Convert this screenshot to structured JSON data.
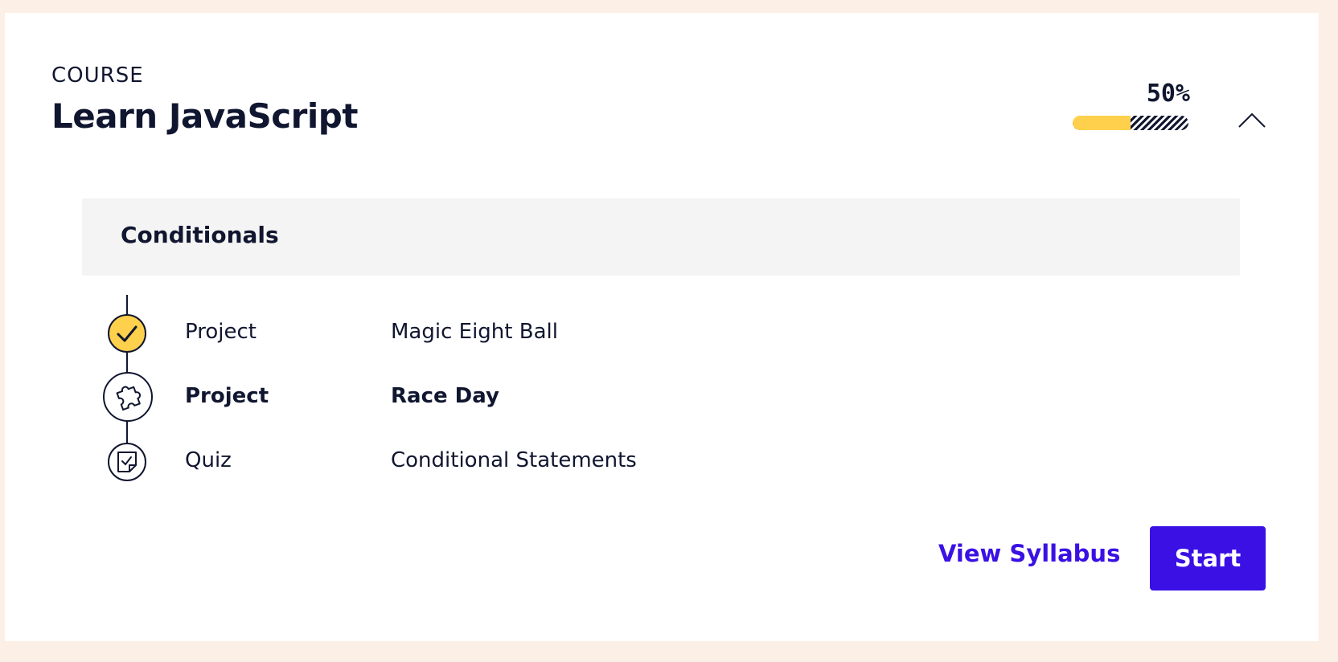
{
  "course": {
    "kicker": "COURSE",
    "title": "Learn JavaScript",
    "progress_label": "50%",
    "progress_fraction": 0.5
  },
  "module": {
    "title": "Conditionals",
    "items": [
      {
        "type": "Project",
        "name": "Magic Eight Ball",
        "status": "completed",
        "icon": "check-icon"
      },
      {
        "type": "Project",
        "name": "Race Day",
        "status": "current",
        "icon": "puzzle-icon"
      },
      {
        "type": "Quiz",
        "name": "Conditional Statements",
        "status": "not-started",
        "icon": "quiz-icon"
      }
    ]
  },
  "actions": {
    "view_syllabus": "View Syllabus",
    "start": "Start"
  },
  "colors": {
    "background": "#fcefe6",
    "accent_yellow": "#ffd04b",
    "primary_blue": "#3a10e5",
    "text_navy": "#10162f"
  }
}
